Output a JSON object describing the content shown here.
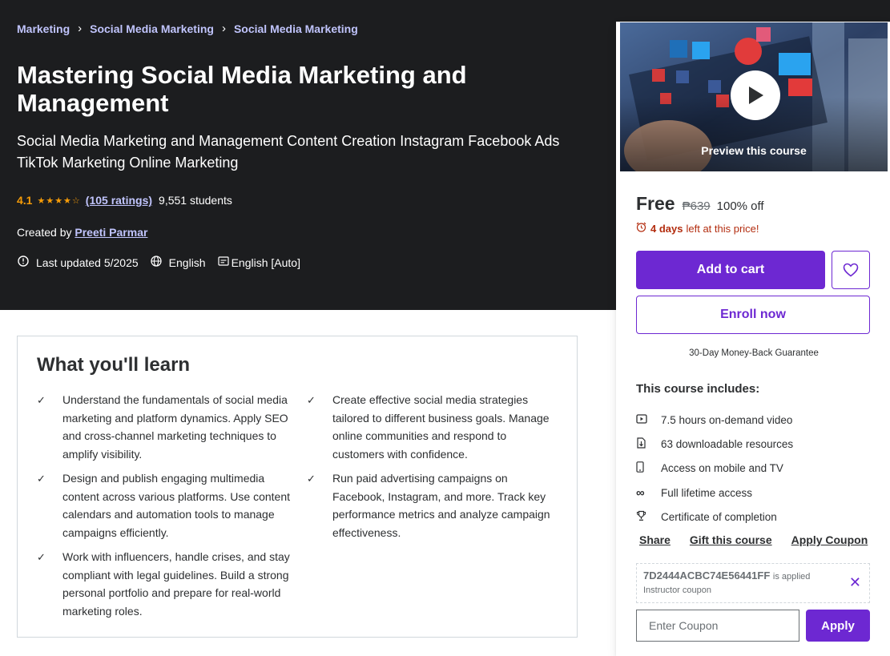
{
  "breadcrumb": [
    "Marketing",
    "Social Media Marketing",
    "Social Media Marketing"
  ],
  "course": {
    "title": "Mastering Social Media Marketing and Management",
    "subtitle": "Social Media Marketing and Management Content Creation Instagram Facebook Ads TikTok Marketing Online Marketing",
    "rating": "4.1",
    "stars": "★★★★☆",
    "ratings_count": "(105 ratings)",
    "students": "9,551 students",
    "created_by_label": "Created by",
    "instructor": "Preeti Parmar",
    "last_updated": "Last updated 5/2025",
    "language": "English",
    "captions": "English [Auto]"
  },
  "learn": {
    "title": "What you'll learn",
    "left": [
      "Understand the fundamentals of social media marketing and platform dynamics. Apply SEO and cross-channel marketing techniques to amplify visibility.",
      "Design and publish engaging multimedia content across various platforms. Use content calendars and automation tools to manage campaigns efficiently.",
      "Work with influencers, handle crises, and stay compliant with legal guidelines. Build a strong personal portfolio and prepare for real-world marketing roles."
    ],
    "right": [
      "Create effective social media strategies tailored to different business goals. Manage online communities and respond to customers with confidence.",
      "Run paid advertising campaigns on Facebook, Instagram, and more. Track key performance metrics and analyze campaign effectiveness."
    ]
  },
  "sidebar": {
    "preview_label": "Preview this course",
    "price": "Free",
    "old_price": "₱639",
    "discount": "100% off",
    "timer_bold": "4 days",
    "timer_rest": "left at this price!",
    "add_to_cart": "Add to cart",
    "enroll": "Enroll now",
    "guarantee": "30-Day Money-Back Guarantee",
    "includes_title": "This course includes:",
    "includes": [
      {
        "icon": "video-icon",
        "text": "7.5 hours on-demand video"
      },
      {
        "icon": "download-icon",
        "text": "63 downloadable resources"
      },
      {
        "icon": "mobile-icon",
        "text": "Access on mobile and TV"
      },
      {
        "icon": "infinity-icon",
        "text": "Full lifetime access"
      },
      {
        "icon": "trophy-icon",
        "text": "Certificate of completion"
      }
    ],
    "links": [
      "Share",
      "Gift this course",
      "Apply Coupon"
    ],
    "coupon_code": "7D2444ACBC74E56441FF",
    "coupon_applied": "is applied",
    "coupon_sub": "Instructor coupon",
    "coupon_placeholder": "Enter Coupon",
    "apply": "Apply"
  },
  "colors": {
    "hero_bg": "#1c1d1f",
    "accent": "#6d28d2",
    "link": "#c0c4fc",
    "star": "#f69c08",
    "urgent": "#b32d0f"
  }
}
